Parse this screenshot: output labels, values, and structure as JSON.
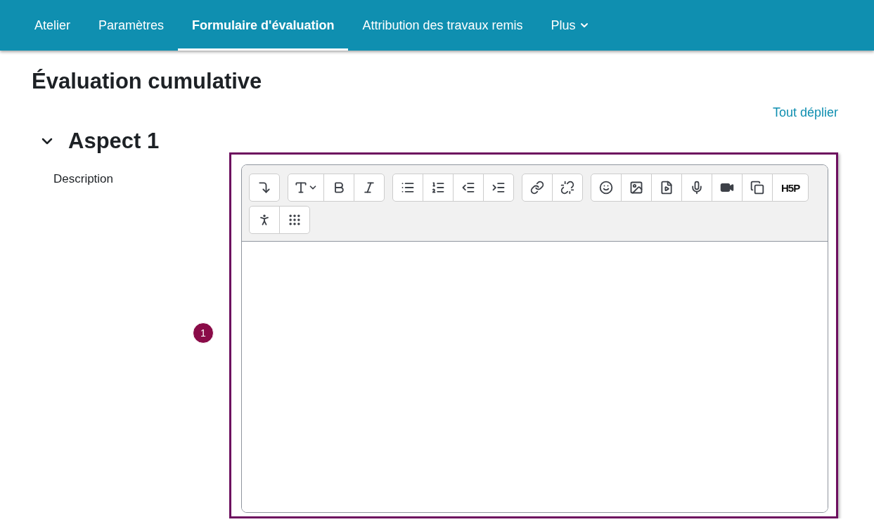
{
  "nav": {
    "tabs": [
      {
        "label": "Atelier",
        "selected": false
      },
      {
        "label": "Paramètres",
        "selected": false
      },
      {
        "label": "Formulaire d'évaluation",
        "selected": true
      },
      {
        "label": "Attribution des travaux remis",
        "selected": false
      }
    ],
    "more": {
      "label": "Plus"
    }
  },
  "page_title": "Évaluation cumulative",
  "expand_all": "Tout déplier",
  "section": {
    "title": "Aspect 1",
    "expanded": true,
    "field_label": "Description",
    "callout": "1",
    "h5p_label": "H5P"
  }
}
